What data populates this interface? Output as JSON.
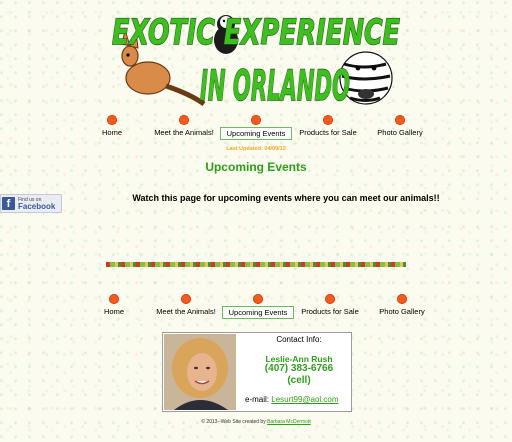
{
  "header": {
    "logo_line1": "EXOTIC EXPERIENCE",
    "logo_line2": "IN ORLANDO"
  },
  "nav_top": [
    {
      "label": "Home"
    },
    {
      "label": "Meet the Animals!"
    },
    {
      "label": "Upcoming Events",
      "active": true
    },
    {
      "label": "Products for Sale"
    },
    {
      "label": "Photo Gallery"
    }
  ],
  "nav_bottom": [
    {
      "label": "Home"
    },
    {
      "label": "Meet the Animals!"
    },
    {
      "label": "Upcoming Events",
      "active": true
    },
    {
      "label": "Products for Sale"
    },
    {
      "label": "Photo Gallery"
    }
  ],
  "last_updated": "Last Updated:  04/09/13",
  "page_title": "Upcoming Events",
  "intro": "Watch this page for upcoming events where you can meet our animals!!",
  "facebook": {
    "small": "Find us on",
    "big": "Facebook",
    "icon": "f"
  },
  "contact": {
    "label": "Contact Info:",
    "name": "Leslie-Ann Rush",
    "phone": "(407) 383-6766",
    "cell": "(cell)",
    "email_label": "e-mail:",
    "email": "Lesurt99@aol.com"
  },
  "footer": {
    "prefix": "© 2013--Web Site created by",
    "author": "Barbara McDermott"
  },
  "colors": {
    "accent_green": "#2f9e1a",
    "nav_dot": "#f15a22",
    "update_orange": "#f5a623"
  }
}
